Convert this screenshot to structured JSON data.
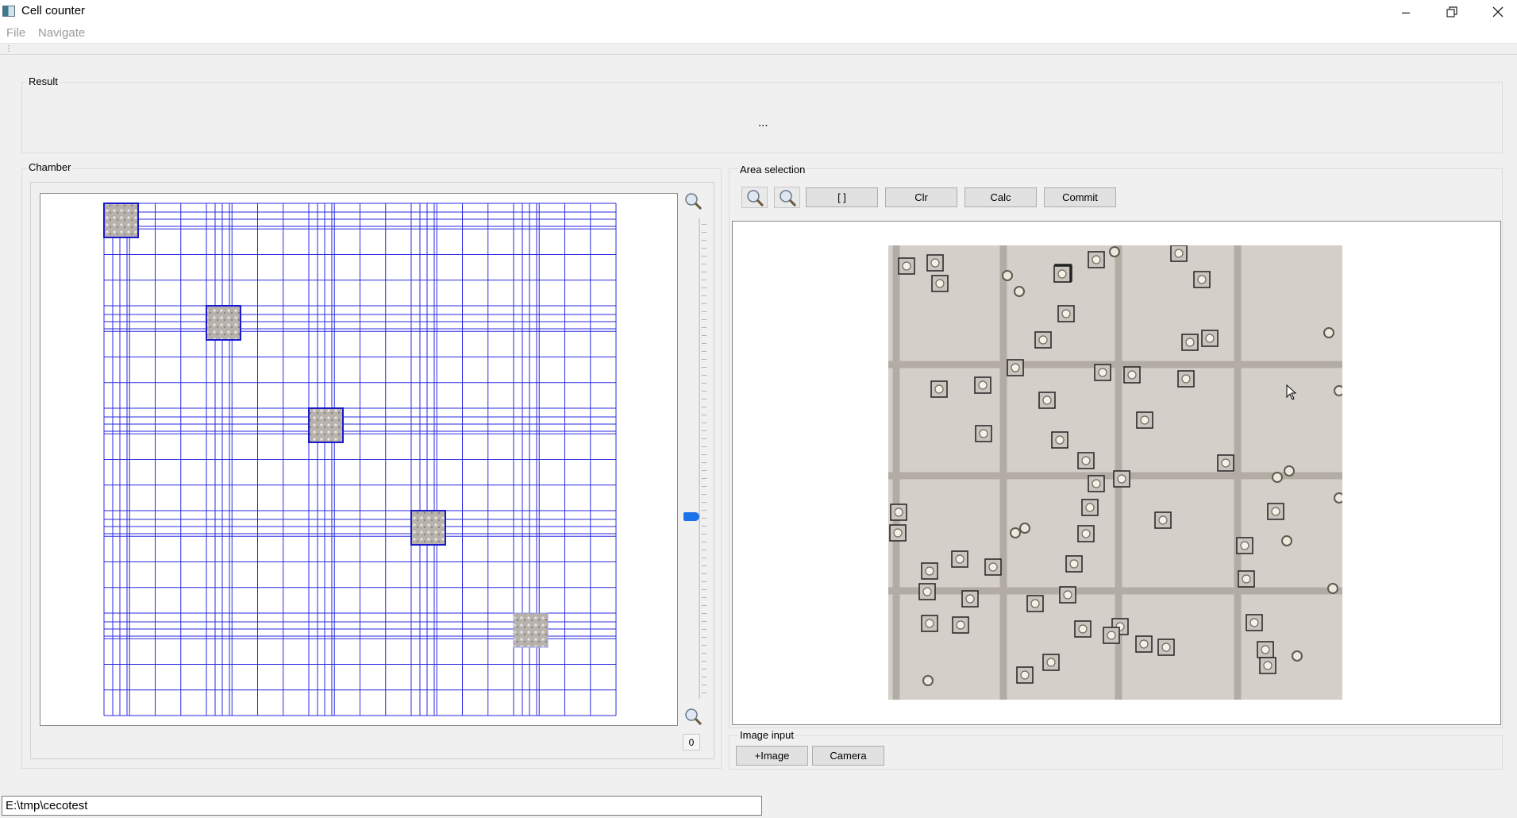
{
  "window": {
    "title": "Cell counter",
    "controls": {
      "minimize": "minimize-icon",
      "maximize": "restore-icon",
      "close": "close-icon"
    }
  },
  "menu": {
    "file": "File",
    "navigate": "Navigate"
  },
  "result": {
    "group_label": "Result",
    "text": "..."
  },
  "chamber": {
    "group_label": "Chamber",
    "count": "0",
    "zoom_in": "zoom-in-icon",
    "zoom_out": "zoom-out-icon"
  },
  "area_selection": {
    "group_label": "Area selection",
    "zoom_in_icon": "zoom-in-icon",
    "zoom_out_icon": "zoom-out-icon",
    "select_button": "[ ]",
    "clr_button": "Clr",
    "calc_button": "Calc",
    "commit_button": "Commit"
  },
  "image_input": {
    "group_label": "Image input",
    "image_button": "+Image",
    "camera_button": "Camera"
  },
  "path": {
    "value": "E:\\tmp\\cecotest"
  },
  "colors": {
    "grid": "#2a2ae0",
    "accent": "#1a73e8",
    "background": "#f0f0f0"
  }
}
